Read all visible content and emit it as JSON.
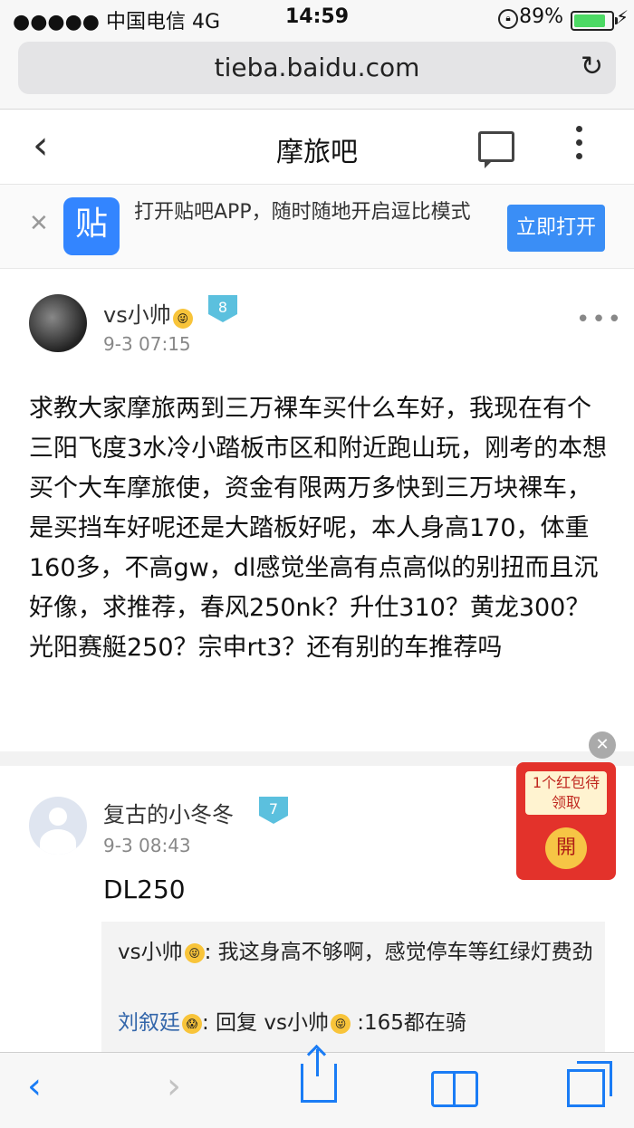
{
  "status_bar": {
    "carrier": "●●●●● 中国电信  4G",
    "time": "14:59",
    "battery_text": "89%",
    "battery_level": 0.89
  },
  "browser": {
    "url": "tieba.baidu.com"
  },
  "nav": {
    "title": "摩旅吧"
  },
  "banner": {
    "logo_text": "贴",
    "promo_text": "打开贴吧APP，随时随地开启逗比模式",
    "open_button": "立即打开"
  },
  "post": {
    "author": "vs小帅",
    "level": "8",
    "date": "9-3 07:15",
    "body": "求教大家摩旅两到三万裸车买什么车好，我现在有个三阳飞度3水冷小踏板市区和附近跑山玩，刚考的本想买个大车摩旅使，资金有限两万多快到三万块裸车，是买挡车好呢还是大踏板好呢，本人身高170，体重160多，不高gw，dl感觉坐高有点高似的别扭而且沉好像，求推荐，春风250nk？升仕310？黄龙300？光阳赛艇250？宗申rt3？还有别的车推荐吗"
  },
  "reply": {
    "author": "复古的小冬冬",
    "level": "7",
    "date": "9-3 08:43",
    "text": "DL250",
    "sub_replies": [
      {
        "author": "vs小帅",
        "text": ": 我这身高不够啊，感觉停车等红绿灯费劲"
      },
      {
        "author": "刘叙廷",
        "text": ": 回复 vs小帅",
        "tail": " :165都在骑"
      }
    ]
  },
  "red_packet": {
    "label": "1个红包待领取",
    "open": "開"
  },
  "icons": {
    "back": "chevron-left-icon",
    "share": "share-icon",
    "bookmarks": "book-icon",
    "tabs": "tabs-icon",
    "reload": "reload-icon"
  },
  "colors": {
    "accent": "#3a8ef6",
    "toolbar_blue": "#1a7cf5",
    "level_badge": "#5bc0de",
    "red_packet": "#e3322b"
  }
}
